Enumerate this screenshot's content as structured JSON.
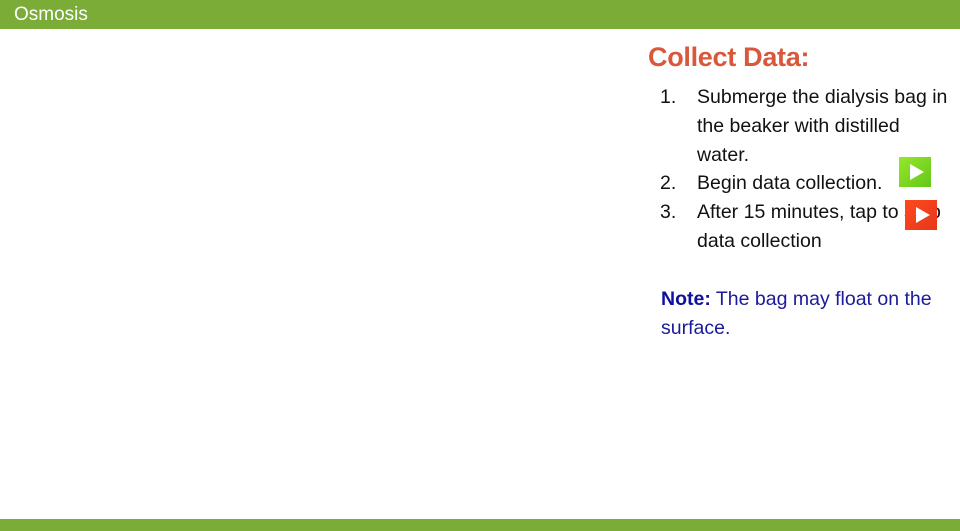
{
  "header": {
    "title": "Osmosis"
  },
  "colors": {
    "bar": "#7aac37",
    "heading": "#d9573a",
    "note": "#1a1a9a",
    "start_button": "#7ad622",
    "stop_button": "#f0401c"
  },
  "main": {
    "heading": "Collect Data:",
    "steps": [
      {
        "num": "1.",
        "text": "Submerge the dialysis bag in the beaker with distilled water."
      },
      {
        "num": "2.",
        "text": "Begin data collection."
      },
      {
        "num": "3.",
        "text": "After 15 minutes, tap     to stop data collection"
      }
    ],
    "start_button": {
      "icon": "play-icon",
      "color": "green"
    },
    "stop_button": {
      "icon": "play-icon",
      "color": "red"
    },
    "note": {
      "label": "Note:",
      "text": " The bag may float on the surface."
    }
  }
}
